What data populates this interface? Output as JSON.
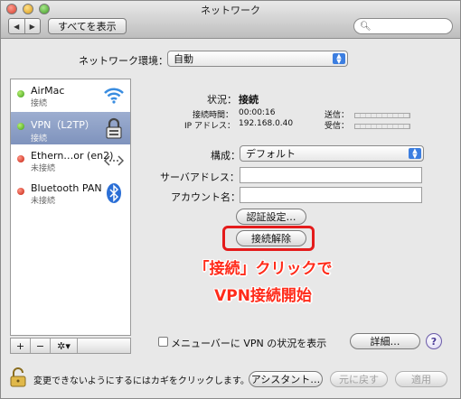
{
  "window": {
    "title": "ネットワーク"
  },
  "toolbar": {
    "back_glyph": "◀",
    "forward_glyph": "▶",
    "show_all_label": "すべてを表示",
    "search_placeholder": "",
    "search_icon": "magnifier-icon"
  },
  "location": {
    "label": "ネットワーク環境：",
    "value": "自動"
  },
  "sidebar": {
    "services": [
      {
        "name": "AirMac",
        "status": "接続",
        "status_color": "green",
        "icon": "wifi-icon"
      },
      {
        "name": "VPN（L2TP）",
        "status": "接続",
        "status_color": "green",
        "icon": "vpn-lock-icon",
        "selected": true
      },
      {
        "name": "Ethern…or (en2)",
        "status": "未接続",
        "status_color": "red",
        "icon": "ethernet-icon"
      },
      {
        "name": "Bluetooth PAN",
        "status": "未接続",
        "status_color": "red",
        "icon": "bluetooth-icon"
      }
    ],
    "tools": {
      "add": "+",
      "remove": "−",
      "gear": "✲▾"
    }
  },
  "detail": {
    "status_label": "状況：",
    "status_value": "接続",
    "connect_time_label": "接続時間：",
    "connect_time_value": "00:00:16",
    "ip_label": "IP アドレス：",
    "ip_value": "192.168.0.40",
    "sent_label": "送信：",
    "received_label": "受信：",
    "config_label": "構成：",
    "config_value": "デフォルト",
    "server_label": "サーバアドレス：",
    "server_value": "",
    "account_label": "アカウント名：",
    "account_value": "",
    "auth_button": "認証設定…",
    "disconnect_button": "接続解除",
    "annotation_line1": "「接続」クリックで",
    "annotation_line2": "VPN接続開始",
    "menubar_checkbox_label": "メニューバーに VPN の状況を表示",
    "advanced_button": "詳細…",
    "help_glyph": "?"
  },
  "bottom": {
    "lock_text": "変更できないようにするにはカギをクリックします。",
    "assistant_button": "アシスタント…",
    "revert_button": "元に戻す",
    "apply_button": "適用"
  },
  "colors": {
    "highlight": "#e41b1b",
    "annotation": "#ff2b1a",
    "selection": "#8b9ec6"
  }
}
